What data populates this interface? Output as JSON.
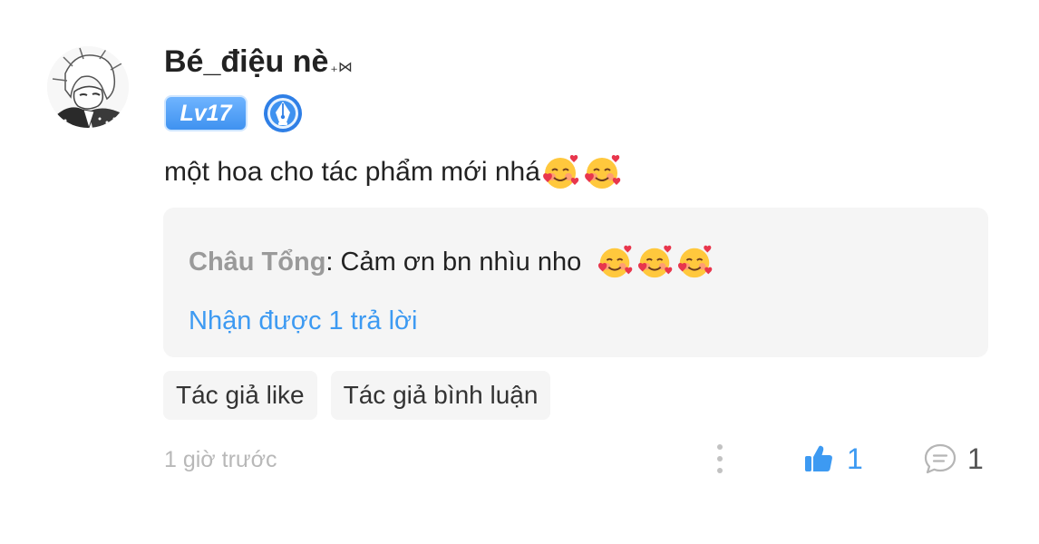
{
  "comment": {
    "author": {
      "name": "Bé_điệu nè",
      "name_decoration": "₊⋈",
      "level": "Lv17",
      "avatar": "anime-avatar",
      "badge_icon": "pen-nib-icon"
    },
    "text": "một hoa cho tác phẩm mới nhá",
    "text_emojis": [
      "smiling-face-with-hearts",
      "smiling-face-with-hearts"
    ],
    "reply_preview": {
      "author": "Châu Tổng",
      "separator": ":",
      "text": " Cảm ơn bn nhìu nho ",
      "emojis": [
        "smiling-face-with-hearts",
        "smiling-face-with-hearts",
        "smiling-face-with-hearts"
      ],
      "more_link": "Nhận được 1 trả lời"
    },
    "tags": [
      "Tác giả like",
      "Tác giả bình luận"
    ],
    "timestamp": "1 giờ trước",
    "actions": {
      "more_icon": "more-vertical-icon",
      "like_icon": "thumbs-up-icon",
      "like_count": "1",
      "reply_icon": "chat-bubble-icon",
      "reply_count": "1"
    }
  },
  "colors": {
    "accent": "#3d9af2",
    "username": "#222222",
    "muted": "#9a9a9a",
    "timestamp": "#b8b8b8",
    "panel_bg": "#f5f5f5"
  }
}
